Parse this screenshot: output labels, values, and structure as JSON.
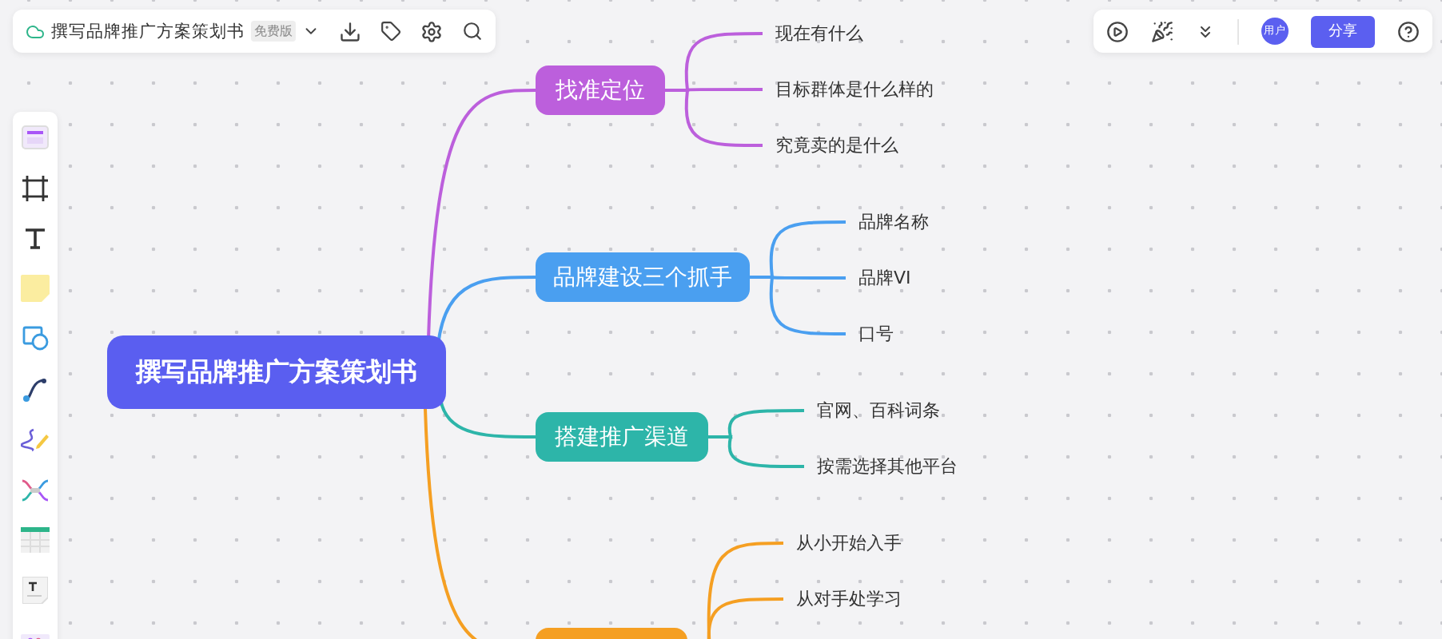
{
  "document": {
    "title": "撰写品牌推广方案策划书",
    "badge": "免费版"
  },
  "top_right": {
    "avatar": "用户",
    "share": "分享"
  },
  "mind_map": {
    "root": "撰写品牌推广方案策划书",
    "branches": [
      {
        "text": "找准定位",
        "color": "#bc5fdc",
        "children": [
          {
            "text": "现在有什么"
          },
          {
            "text": "目标群体是什么样的"
          },
          {
            "text": "究竟卖的是什么"
          }
        ]
      },
      {
        "text": "品牌建设三个抓手",
        "color": "#4a9ff0",
        "children": [
          {
            "text": "品牌名称"
          },
          {
            "text": "品牌VI"
          },
          {
            "text": "口号"
          }
        ]
      },
      {
        "text": "搭建推广渠道",
        "color": "#2db5a9",
        "children": [
          {
            "text": "官网、百科词条"
          },
          {
            "text": "按需选择其他平台"
          }
        ]
      },
      {
        "color": "#f59f22",
        "children": [
          {
            "text": "从小开始入手"
          },
          {
            "text": "从对手处学习"
          }
        ]
      }
    ]
  }
}
